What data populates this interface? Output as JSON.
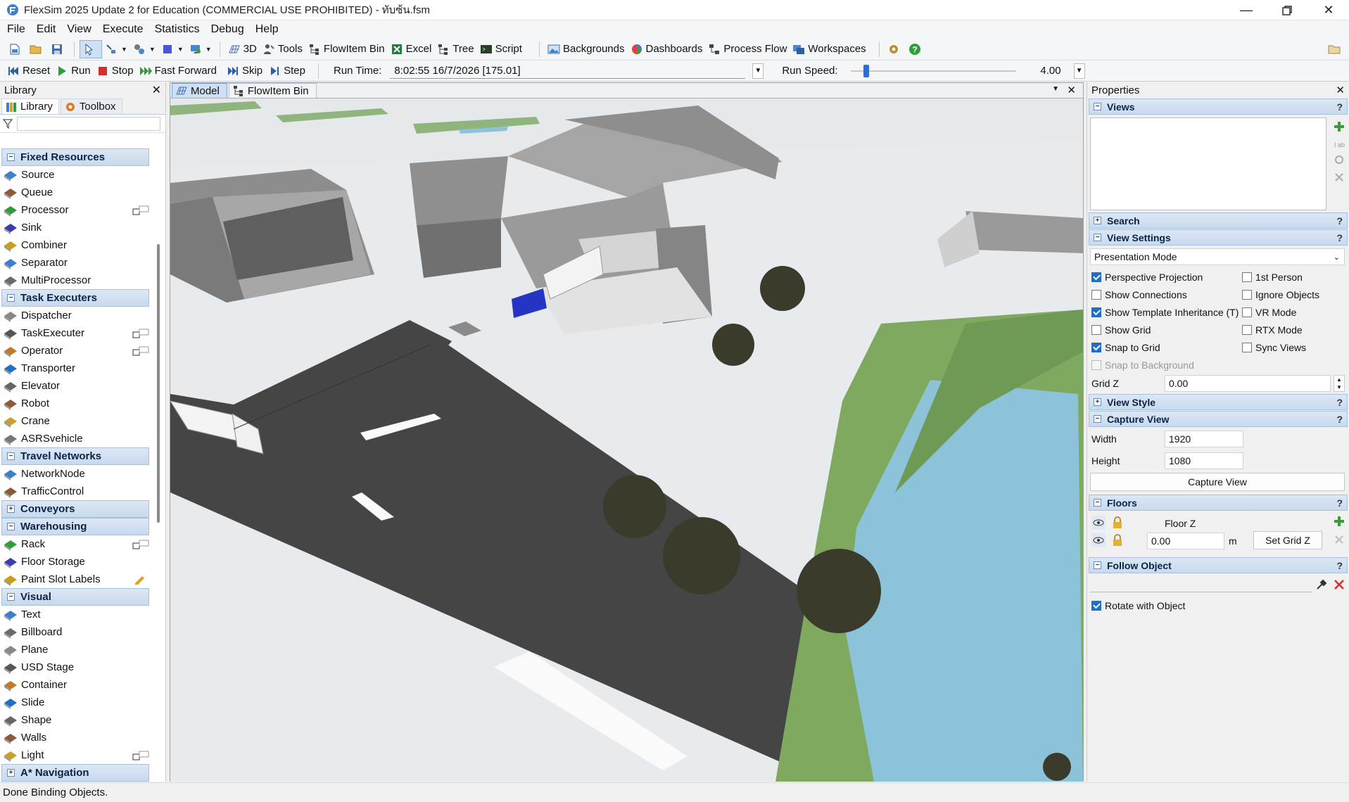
{
  "window": {
    "title": "FlexSim 2025 Update 2 for Education (COMMERCIAL USE PROHIBITED) - ทับซ้น.fsm"
  },
  "menu": [
    "File",
    "Edit",
    "View",
    "Execute",
    "Statistics",
    "Debug",
    "Help"
  ],
  "toolbar": {
    "3d": "3D",
    "tools": "Tools",
    "flowitem_bin": "FlowItem Bin",
    "excel": "Excel",
    "tree": "Tree",
    "script": "Script",
    "backgrounds": "Backgrounds",
    "dashboards": "Dashboards",
    "process_flow": "Process Flow",
    "workspaces": "Workspaces"
  },
  "run": {
    "reset": "Reset",
    "run": "Run",
    "stop": "Stop",
    "fast_forward": "Fast Forward",
    "skip": "Skip",
    "step": "Step",
    "runtime_label": "Run Time:",
    "runtime_value": "8:02:55  16/7/2026  [175.01]",
    "speed_label": "Run Speed:",
    "speed_value": "4.00"
  },
  "library": {
    "title": "Library",
    "tab_library": "Library",
    "tab_toolbox": "Toolbox",
    "groups": [
      {
        "name": "Fixed Resources",
        "items": [
          "Source",
          "Queue",
          "Processor",
          "Sink",
          "Combiner",
          "Separator",
          "MultiProcessor"
        ]
      },
      {
        "name": "Task Executers",
        "items": [
          "Dispatcher",
          "TaskExecuter",
          "Operator",
          "Transporter",
          "Elevator",
          "Robot",
          "Crane",
          "ASRSvehicle"
        ]
      },
      {
        "name": "Travel Networks",
        "items": [
          "NetworkNode",
          "TrafficControl"
        ]
      },
      {
        "name": "Conveyors",
        "items": []
      },
      {
        "name": "Warehousing",
        "items": [
          "Rack",
          "Floor Storage",
          "Paint Slot Labels"
        ]
      },
      {
        "name": "Visual",
        "items": [
          "Text",
          "Billboard",
          "Plane",
          "USD Stage",
          "Container",
          "Slide",
          "Shape",
          "Walls",
          "Light"
        ]
      },
      {
        "name": "A* Navigation",
        "items": []
      }
    ]
  },
  "viewport": {
    "tab_model": "Model",
    "tab_flowitem": "FlowItem Bin"
  },
  "properties": {
    "title": "Properties",
    "sections": {
      "views": "Views",
      "search": "Search",
      "view_settings": "View Settings",
      "view_style": "View Style",
      "capture_view": "Capture View",
      "floors": "Floors",
      "follow_object": "Follow Object"
    },
    "view_mode": "Presentation Mode",
    "checkboxes_left": [
      {
        "label": "Perspective Projection",
        "checked": true
      },
      {
        "label": "Show Connections",
        "checked": false
      },
      {
        "label": "Show Template Inheritance (T)",
        "checked": true
      },
      {
        "label": "Show Grid",
        "checked": false
      },
      {
        "label": "Snap to Grid",
        "checked": true
      },
      {
        "label": "Snap to Background",
        "checked": false
      }
    ],
    "checkboxes_right": [
      {
        "label": "1st Person",
        "checked": false
      },
      {
        "label": "Ignore Objects",
        "checked": false
      },
      {
        "label": "VR Mode",
        "checked": false
      },
      {
        "label": "RTX Mode",
        "checked": false
      },
      {
        "label": "Sync Views",
        "checked": false
      }
    ],
    "grid_z_label": "Grid Z",
    "grid_z_value": "0.00",
    "width_label": "Width",
    "width_value": "1920",
    "height_label": "Height",
    "height_value": "1080",
    "capture_button": "Capture View",
    "floor_z_label": "Floor Z",
    "floor_z_value": "0.00",
    "floor_unit": "m",
    "set_grid_z": "Set Grid Z",
    "rotate_with_object": "Rotate with Object"
  },
  "status": "Done Binding Objects.",
  "colors": {
    "accent": "#1f6fc9",
    "section_header": "#c9daee",
    "water": "#8cc3d8",
    "floor": "#e8ebee",
    "road": "#454545"
  }
}
